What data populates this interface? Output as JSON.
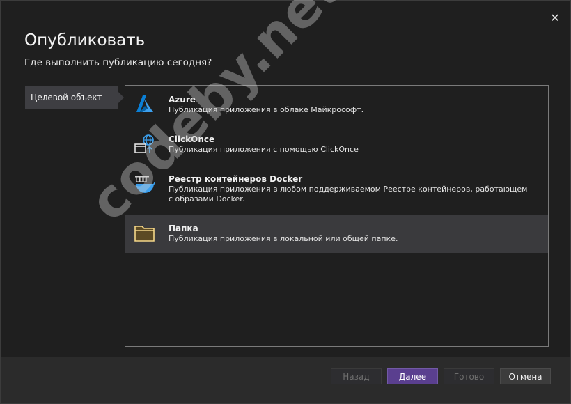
{
  "dialog": {
    "title": "Опубликовать",
    "subtitle": "Где выполнить публикацию сегодня?",
    "close_glyph": "✕"
  },
  "sidebar": {
    "steps": [
      {
        "label": "Целевой объект",
        "active": true
      }
    ]
  },
  "targets": [
    {
      "icon": "azure-icon",
      "title": "Azure",
      "description": "Публикация приложения в облаке Майкрософт.",
      "selected": false
    },
    {
      "icon": "clickonce-icon",
      "title": "ClickOnce",
      "description": "Публикация приложения с помощью ClickOnce",
      "selected": false
    },
    {
      "icon": "docker-icon",
      "title": "Реестр контейнеров Docker",
      "description": "Публикация приложения в любом поддерживаемом Реестре контейнеров, работающем с образами Docker.",
      "selected": false
    },
    {
      "icon": "folder-icon",
      "title": "Папка",
      "description": "Публикация приложения в локальной или общей папке.",
      "selected": true
    }
  ],
  "buttons": {
    "back": "Назад",
    "next": "Далее",
    "finish": "Готово",
    "cancel": "Отмена"
  },
  "watermark": "codeby.net",
  "colors": {
    "accent": "#5a3f8f",
    "selected_bg": "#3a3a3d",
    "azure_blue": "#0a7fd6",
    "folder_yellow": "#f5d889"
  }
}
